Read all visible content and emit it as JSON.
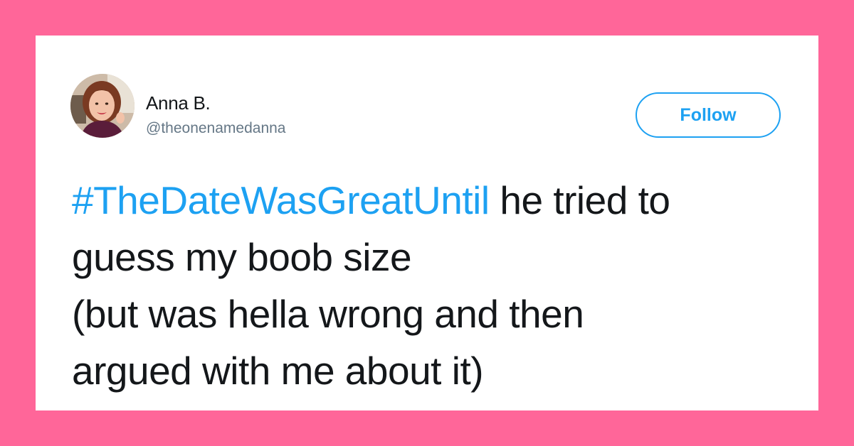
{
  "colors": {
    "background": "#ff6699",
    "card": "#ffffff",
    "accent": "#1da1f2",
    "text": "#14171a",
    "muted": "#657786"
  },
  "author": {
    "display_name": "Anna B.",
    "handle": "@theonenamedanna",
    "avatar_icon": "profile-photo"
  },
  "actions": {
    "follow_label": "Follow"
  },
  "tweet": {
    "hashtag": "#TheDateWasGreatUntil",
    "line1_rest": " he tried to",
    "line2": "guess my boob size",
    "line3": "(but was hella wrong and then",
    "line4": "argued with me about it)"
  }
}
